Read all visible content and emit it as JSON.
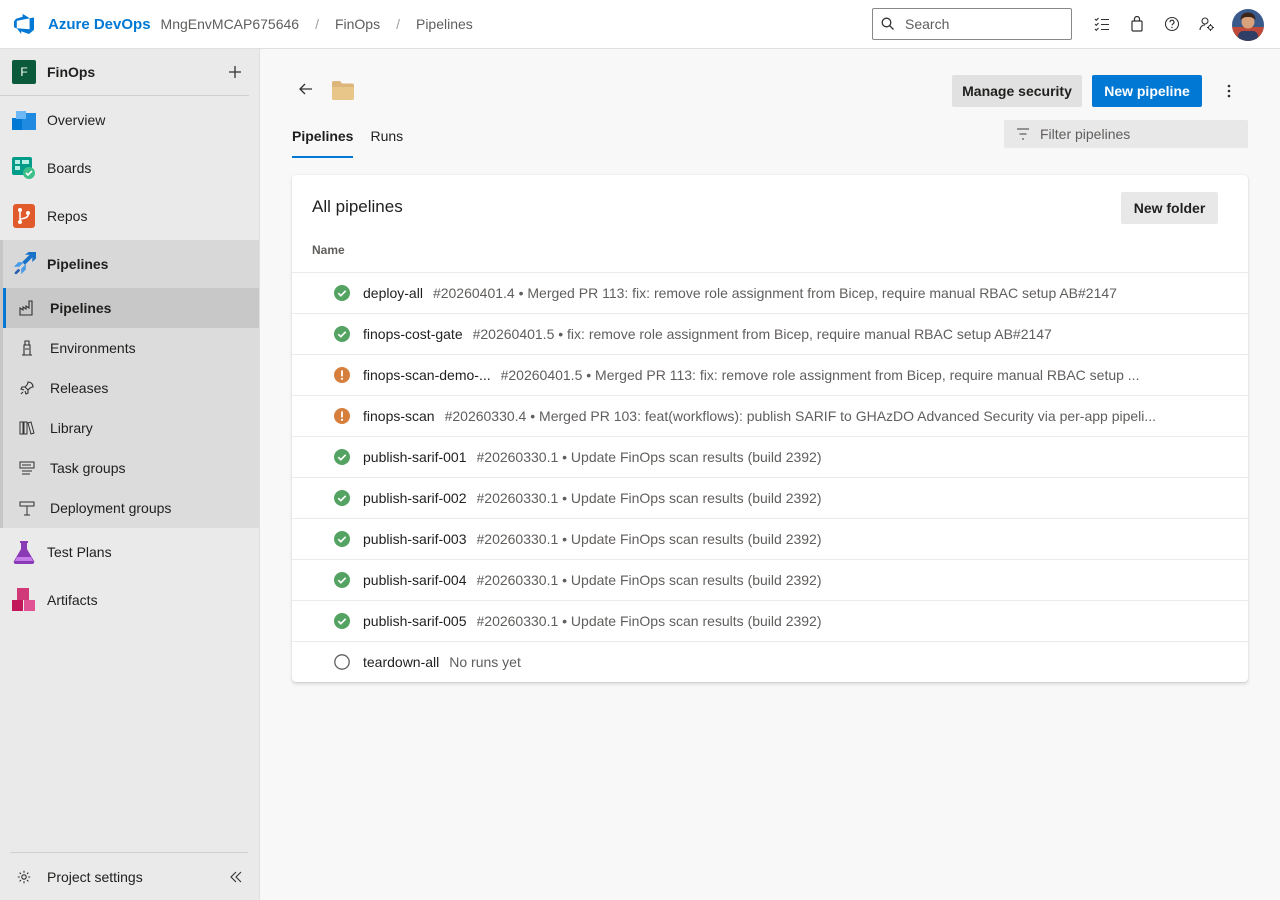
{
  "topbar": {
    "brand": "Azure DevOps",
    "breadcrumbs": [
      "MngEnvMCAP675646",
      "FinOps",
      "Pipelines"
    ],
    "search_placeholder": "Search"
  },
  "sidebar": {
    "project_badge": "F",
    "project_name": "FinOps",
    "items": [
      {
        "label": "Overview",
        "icon": "overview-icon"
      },
      {
        "label": "Boards",
        "icon": "boards-icon"
      },
      {
        "label": "Repos",
        "icon": "repos-icon"
      },
      {
        "label": "Pipelines",
        "icon": "pipelines-icon"
      }
    ],
    "pipeline_subitems": [
      {
        "label": "Pipelines",
        "icon": "pipelines-sub-icon"
      },
      {
        "label": "Environments",
        "icon": "environments-icon"
      },
      {
        "label": "Releases",
        "icon": "releases-icon"
      },
      {
        "label": "Library",
        "icon": "library-icon"
      },
      {
        "label": "Task groups",
        "icon": "task-groups-icon"
      },
      {
        "label": "Deployment groups",
        "icon": "deployment-groups-icon"
      }
    ],
    "bottom_items": [
      {
        "label": "Test Plans",
        "icon": "test-plans-icon"
      },
      {
        "label": "Artifacts",
        "icon": "artifacts-icon"
      }
    ],
    "project_settings": "Project settings"
  },
  "main": {
    "manage_security": "Manage security",
    "new_pipeline": "New pipeline",
    "tabs": [
      "Pipelines",
      "Runs"
    ],
    "filter_placeholder": "Filter pipelines",
    "card_title": "All pipelines",
    "new_folder": "New folder",
    "column_name": "Name",
    "pipelines": [
      {
        "name": "deploy-all",
        "status": "success",
        "desc": "#20260401.4 • Merged PR 113: fix: remove role assignment from Bicep, require manual RBAC setup AB#2147"
      },
      {
        "name": "finops-cost-gate",
        "status": "success",
        "desc": "#20260401.5 • fix: remove role assignment from Bicep, require manual RBAC setup AB#2147"
      },
      {
        "name": "finops-scan-demo-...",
        "status": "warning",
        "desc": "#20260401.5 • Merged PR 113: fix: remove role assignment from Bicep, require manual RBAC setup ..."
      },
      {
        "name": "finops-scan",
        "status": "warning",
        "desc": "#20260330.4 • Merged PR 103: feat(workflows): publish SARIF to GHAzDO Advanced Security via per-app pipeli..."
      },
      {
        "name": "publish-sarif-001",
        "status": "success",
        "desc": "#20260330.1 • Update FinOps scan results (build 2392)"
      },
      {
        "name": "publish-sarif-002",
        "status": "success",
        "desc": "#20260330.1 • Update FinOps scan results (build 2392)"
      },
      {
        "name": "publish-sarif-003",
        "status": "success",
        "desc": "#20260330.1 • Update FinOps scan results (build 2392)"
      },
      {
        "name": "publish-sarif-004",
        "status": "success",
        "desc": "#20260330.1 • Update FinOps scan results (build 2392)"
      },
      {
        "name": "publish-sarif-005",
        "status": "success",
        "desc": "#20260330.1 • Update FinOps scan results (build 2392)"
      },
      {
        "name": "teardown-all",
        "status": "none",
        "desc": "No runs yet"
      }
    ]
  },
  "colors": {
    "accent": "#0078d4",
    "success": "#55a362",
    "warning": "#d67f3c",
    "project_badge": "#0b5a3c"
  }
}
